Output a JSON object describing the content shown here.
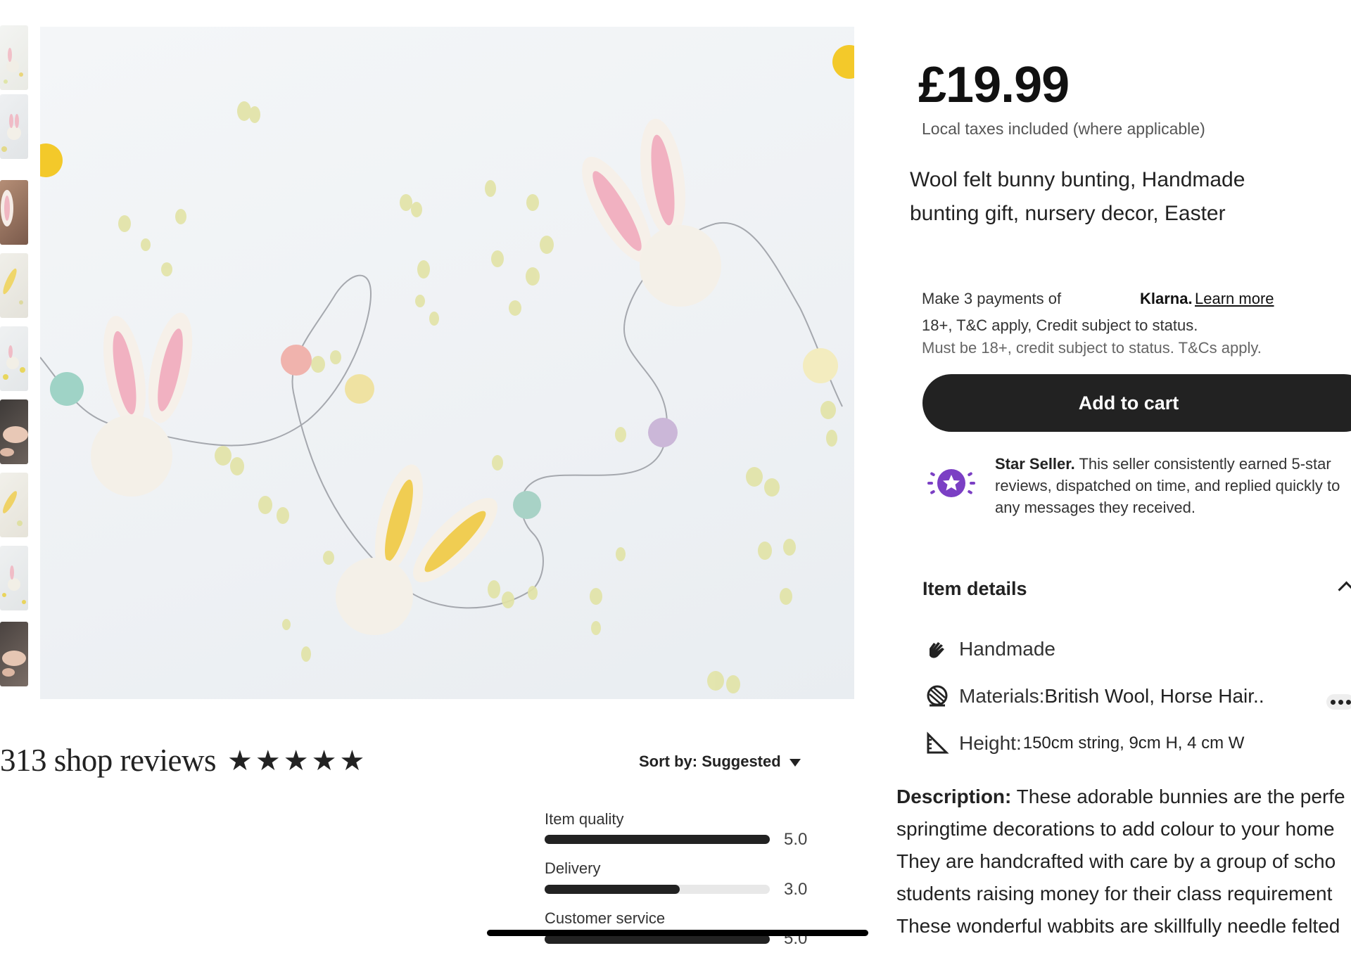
{
  "listing": {
    "price": "£19.99",
    "tax_note": "Local taxes included (where applicable)",
    "title": "Wool felt bunny bunting, Handmade bunting gift, nursery decor, Easter"
  },
  "payments": {
    "klarna_line": "Make 3 payments of",
    "klarna_brand": "Klarna.",
    "learn_more": "Learn more",
    "credit_line_1": "18+, T&C apply, Credit subject to status.",
    "credit_line_2": "Must be 18+, credit subject to status. T&Cs apply."
  },
  "cart": {
    "add_label": "Add to cart"
  },
  "star_seller": {
    "heading": "Star Seller.",
    "text": "This seller consistently earned 5-star reviews, dispatched on time, and replied quickly to any messages they received."
  },
  "item_details": {
    "heading": "Item details",
    "handmade": "Handmade",
    "materials_label": "Materials:",
    "materials_value": "British Wool, Horse Hair..",
    "height_label": "Height:",
    "height_value": "150cm string, 9cm H, 4 cm W"
  },
  "description": {
    "label": "Description:",
    "lines": [
      "These adorable bunnies are the perfe",
      "springtime decorations to add colour to your home",
      "They are handcrafted with care by a group of scho",
      "students raising money for their class requirement",
      "These wonderful wabbits are skillfully needle felted"
    ]
  },
  "reviews": {
    "title": "313 shop reviews",
    "stars": 5,
    "sort_label": "Sort by: Suggested",
    "ratings": [
      {
        "label": "Item quality",
        "value": "5.0",
        "fraction": 1.0
      },
      {
        "label": "Delivery",
        "value": "3.0",
        "fraction": 0.6
      },
      {
        "label": "Customer service",
        "value": "5.0",
        "fraction": 1.0
      }
    ]
  },
  "icons": {
    "star_seller": "star-seller-badge-icon",
    "handmade": "hand-icon",
    "materials": "yarn-ball-icon",
    "height": "ruler-triangle-icon",
    "sort": "caret-down-icon",
    "collapse": "chevron-up-icon"
  },
  "colors": {
    "button": "#222222",
    "star_seller_accent": "#7b3fc4",
    "bar_track": "#e8e8e8",
    "bar_fill": "#222222"
  }
}
